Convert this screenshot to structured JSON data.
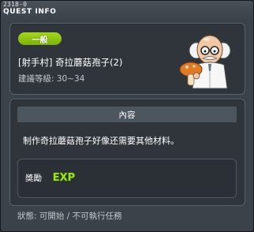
{
  "window": {
    "quest_id": "2318-0",
    "title": "QUEST INFO"
  },
  "quest": {
    "category": "一般",
    "name": "[射手村] 奇拉蘑菇孢子(2)",
    "recommended_level": "建議等級: 30~34",
    "npc_icon": "scientist-npc-with-mushroom"
  },
  "content": {
    "header": "內容",
    "description": "制作奇拉蘑菇孢子好像还需要其他材料。"
  },
  "reward": {
    "label": "獎勵",
    "exp_icon": "exp-icon",
    "exp_text": "EXP"
  },
  "status": {
    "text": "狀態: 可開始 / 不可執行任務"
  },
  "colors": {
    "badge_green": "#8cc516",
    "exp_green": "#9be21a",
    "panel_bg": "#2f353b",
    "window_bg": "#3c4249"
  }
}
